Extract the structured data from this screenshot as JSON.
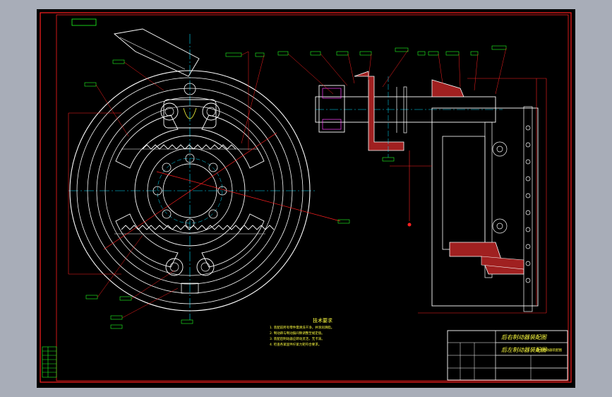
{
  "title_block": {
    "title_line_1": "后右制动器装配图",
    "title_line_2": "后左制动器装配图",
    "drawing_no": "",
    "note": "盘式制动器装配图"
  },
  "tech_requirements": {
    "heading": "技术要求",
    "items": [
      "1. 装配前所有零件需清洗干净，并涂润滑脂。",
      "2. 制动蹄与制动鼓间隙调整至规定值。",
      "3. 装配后制动器应转动灵活，无卡滞。",
      "4. 检查各紧固件拧紧力矩符合要求。"
    ]
  },
  "corner_tag": "",
  "colors": {
    "background": "#a8adb8",
    "sheet": "#000000",
    "border": "#ff2020",
    "geometry": "#ffffff",
    "center_line": "#00e0ff",
    "leader": "#ff2020",
    "label": "#20ff20",
    "section_fill": "#a02020",
    "text": "#ffff40",
    "hatch": "#ff40ff"
  }
}
